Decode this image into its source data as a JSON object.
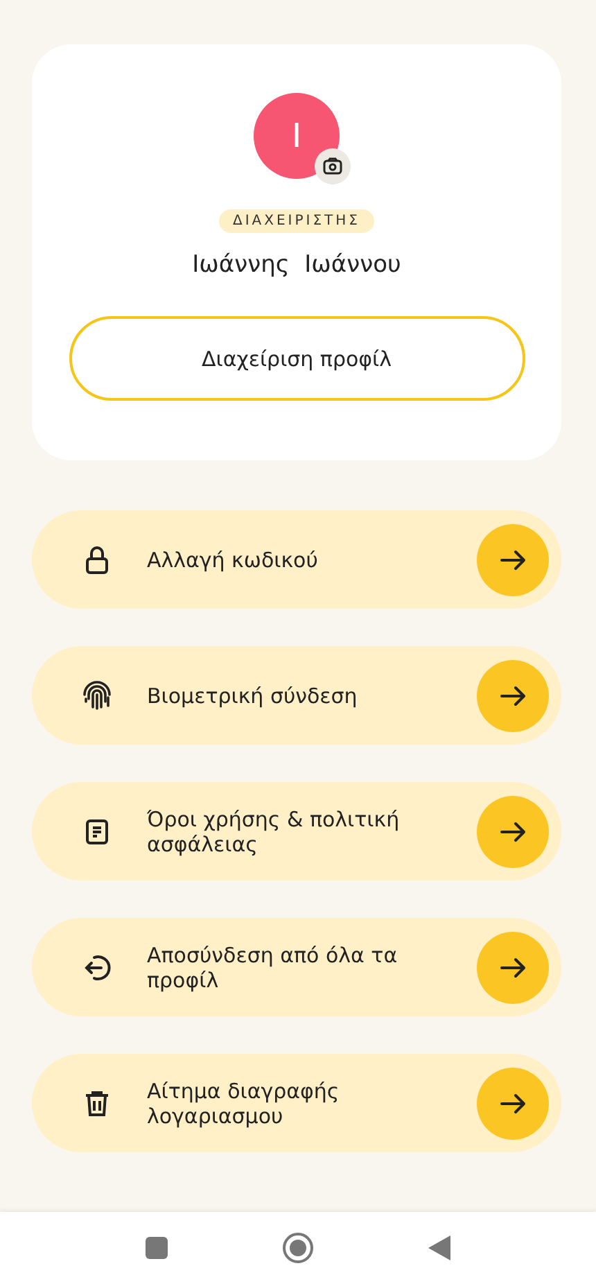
{
  "profile": {
    "avatar_letter": "I",
    "role_badge": "ΔΙΑΧΕΙΡΙΣΤΗΣ",
    "name": "Ιωάννης  Ιωάννου",
    "manage_button": "Διαχείριση προφίλ"
  },
  "menu": [
    {
      "kind": "lock",
      "label": "Αλλαγή κωδικού"
    },
    {
      "kind": "fingerprint",
      "label": "Βιομετρική σύνδεση"
    },
    {
      "kind": "document",
      "label": "Όροι χρήσης & πολιτική ασφάλειας"
    },
    {
      "kind": "logout",
      "label": "Αποσύνδεση από όλα τα προφίλ"
    },
    {
      "kind": "trash",
      "label": "Αίτημα διαγραφής λογαριασμου"
    }
  ]
}
